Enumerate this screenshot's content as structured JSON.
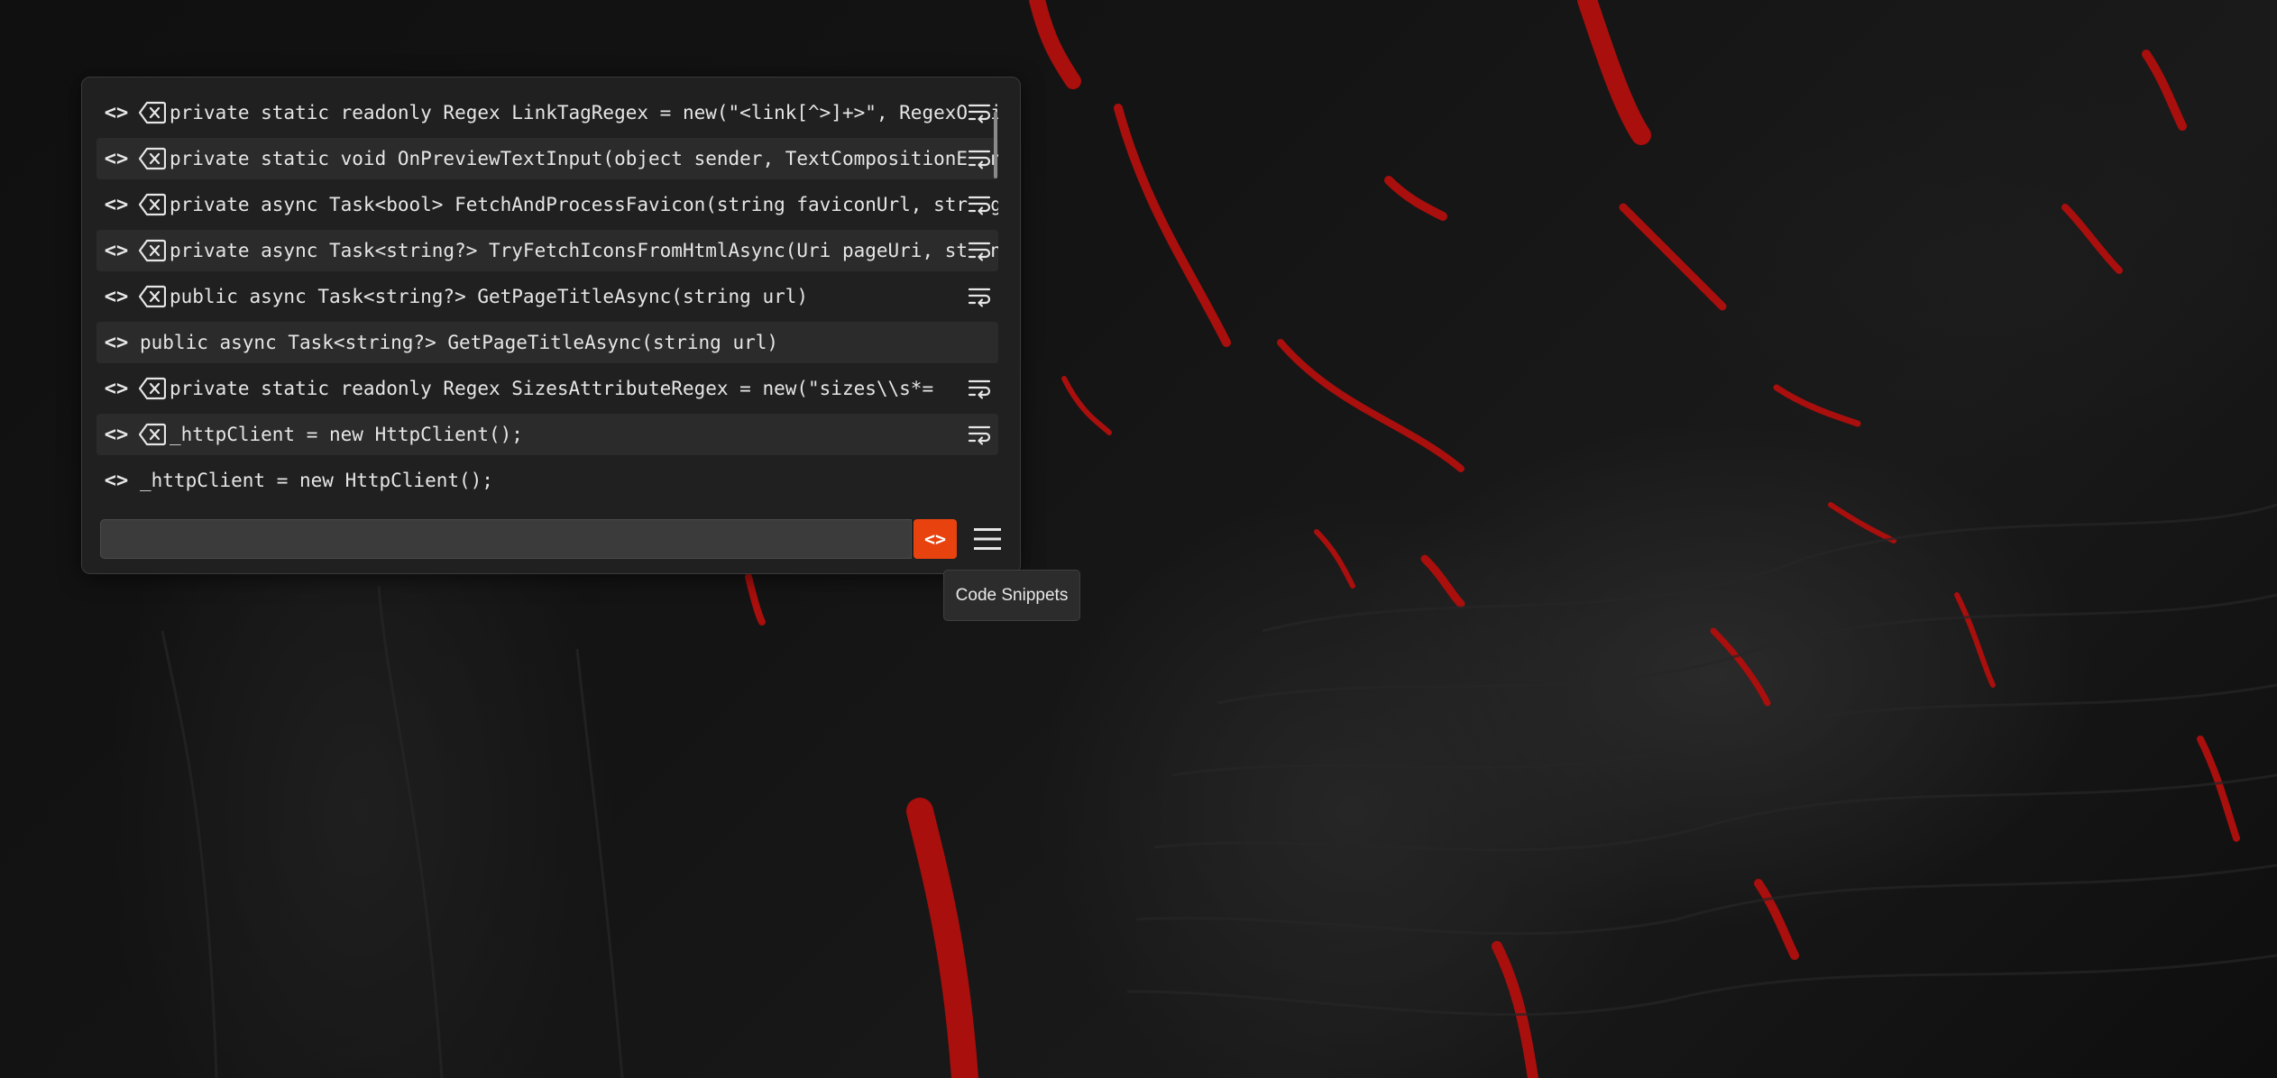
{
  "background": {
    "base_color": "#111111",
    "lava_color": "#b5100e"
  },
  "snippets": [
    {
      "text": "private static readonly Regex LinkTagRegex = new(\"<link[^>]+>\", RegexOptions.IgnoreCase);",
      "deletable": true,
      "highlight": false
    },
    {
      "text": "private static void OnPreviewTextInput(object sender, TextCompositionEventArgs e)",
      "deletable": true,
      "highlight": true
    },
    {
      "text": "private async Task<bool> FetchAndProcessFavicon(string faviconUrl, string cachePath)",
      "deletable": true,
      "highlight": false
    },
    {
      "text": "private async Task<string?> TryFetchIconsFromHtmlAsync(Uri pageUri, string cachePath)",
      "deletable": true,
      "highlight": true
    },
    {
      "text": "public async Task<string?> GetPageTitleAsync(string url)",
      "deletable": true,
      "highlight": false
    },
    {
      "text": "public async Task<string?> GetPageTitleAsync(string url)",
      "deletable": false,
      "highlight": true
    },
    {
      "text": "private static readonly Regex SizesAttributeRegex = new(\"sizes\\\\s*=",
      "deletable": true,
      "highlight": false
    },
    {
      "text": "_httpClient = new HttpClient();",
      "deletable": true,
      "highlight": true
    },
    {
      "text": "_httpClient = new HttpClient();",
      "deletable": false,
      "highlight": false
    }
  ],
  "icons": {
    "code": "<>",
    "delete": "backspace-x-icon",
    "wrap": "text-wrap-icon",
    "menu": "hamburger-menu-icon"
  },
  "search": {
    "value": "",
    "placeholder": ""
  },
  "code_button_label": "<>",
  "accent_color": "#e8430e",
  "tooltip": "Code Snippets"
}
